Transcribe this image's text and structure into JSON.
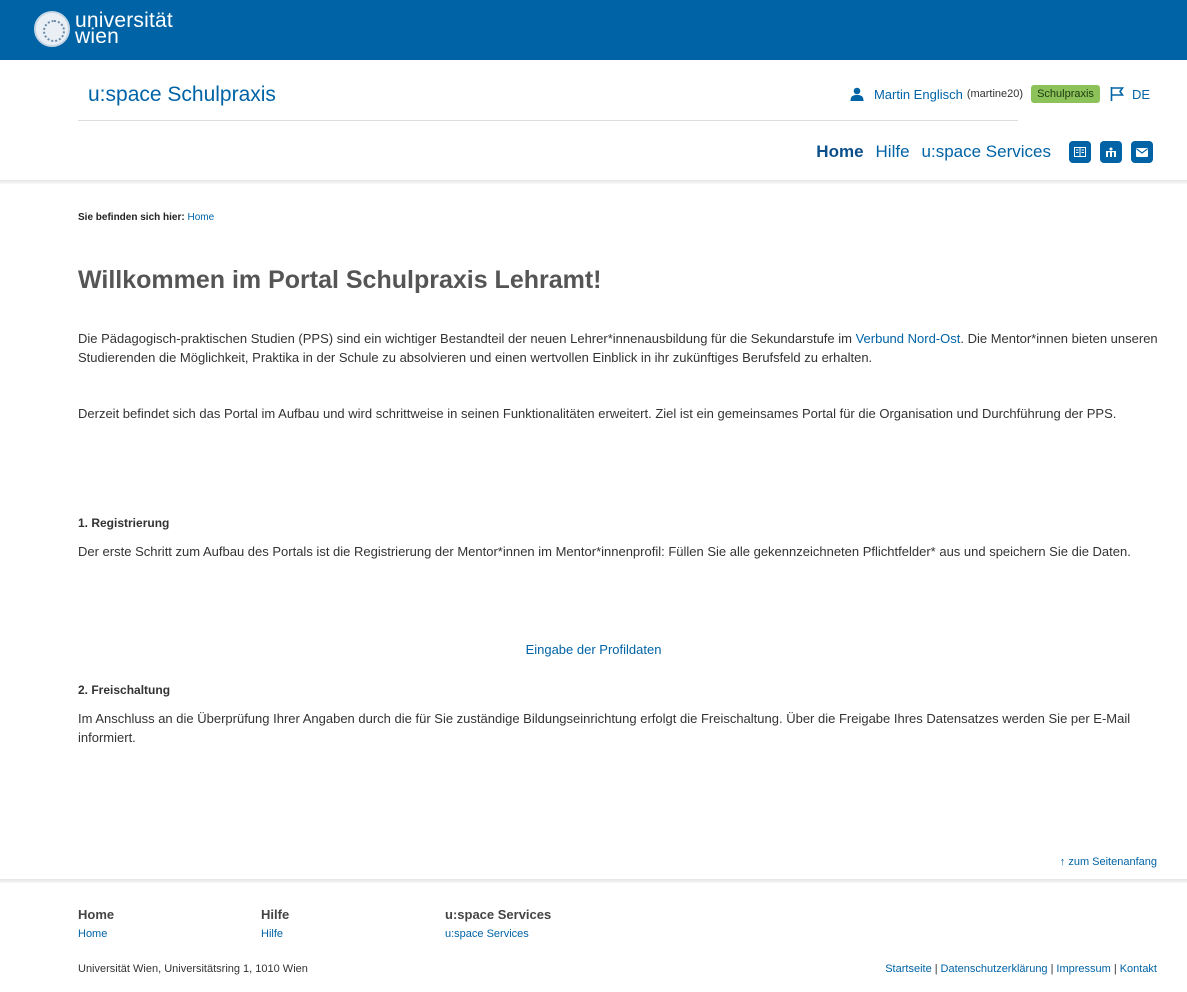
{
  "brand": {
    "logo_line1": "universität",
    "logo_line2": "wien"
  },
  "header": {
    "app_title": "u:space Schulpraxis",
    "user_name": "Martin Englisch",
    "user_id": "(martine20)",
    "role_badge": "Schulpraxis",
    "language": "DE"
  },
  "nav": {
    "items": [
      "Home",
      "Hilfe",
      "u:space Services"
    ],
    "icon_buttons": [
      "book-icon",
      "org-icon",
      "mail-icon"
    ]
  },
  "breadcrumb": {
    "label": "Sie befinden sich hier:",
    "current": "Home"
  },
  "main": {
    "title": "Willkommen im Portal Schulpraxis Lehramt!",
    "intro_before_link": "Die Pädagogisch-praktischen Studien (PPS) sind ein wichtiger Bestandteil der neuen Lehrer*innenausbildung für die Sekundarstufe im ",
    "intro_link": "Verbund Nord-Ost",
    "intro_after_link": ". Die Mentor*innen bieten unseren Studierenden die Möglichkeit, Praktika in der Schule zu absolvieren und einen wertvollen Einblick in ihr zukünftiges Berufsfeld zu erhalten.",
    "para2": "Derzeit befindet sich das Portal im Aufbau und wird schrittweise in seinen Funktionalitäten erweitert. Ziel ist ein gemeinsames Portal für die Organisation und Durchführung der PPS.",
    "section1_title": "1. Registrierung",
    "section1_text": "Der erste Schritt zum Aufbau des Portals ist die Registrierung der Mentor*innen im Mentor*innenprofil: Füllen Sie alle gekennzeichneten Pflichtfelder* aus und speichern Sie die Daten.",
    "profile_link": "Eingabe der Profildaten",
    "section2_title": "2. Freischaltung",
    "section2_text": "Im Anschluss an die Überprüfung Ihrer Angaben durch die für Sie zuständige Bildungseinrichtung erfolgt die Freischaltung. Über die Freigabe Ihres Datensatzes werden Sie per E-Mail informiert."
  },
  "footer": {
    "to_top": "↑ zum Seitenanfang",
    "columns": [
      {
        "heading": "Home",
        "link": "Home"
      },
      {
        "heading": "Hilfe",
        "link": "Hilfe"
      },
      {
        "heading": "u:space Services",
        "link": "u:space Services"
      }
    ],
    "address": "Universität Wien, Universitätsring 1, 1010 Wien",
    "legal_links": [
      "Startseite",
      "Datenschutzerklärung",
      "Impressum",
      "Kontakt"
    ]
  },
  "colors": {
    "brand_blue": "#0063a6",
    "badge_green": "#8dc25a"
  }
}
